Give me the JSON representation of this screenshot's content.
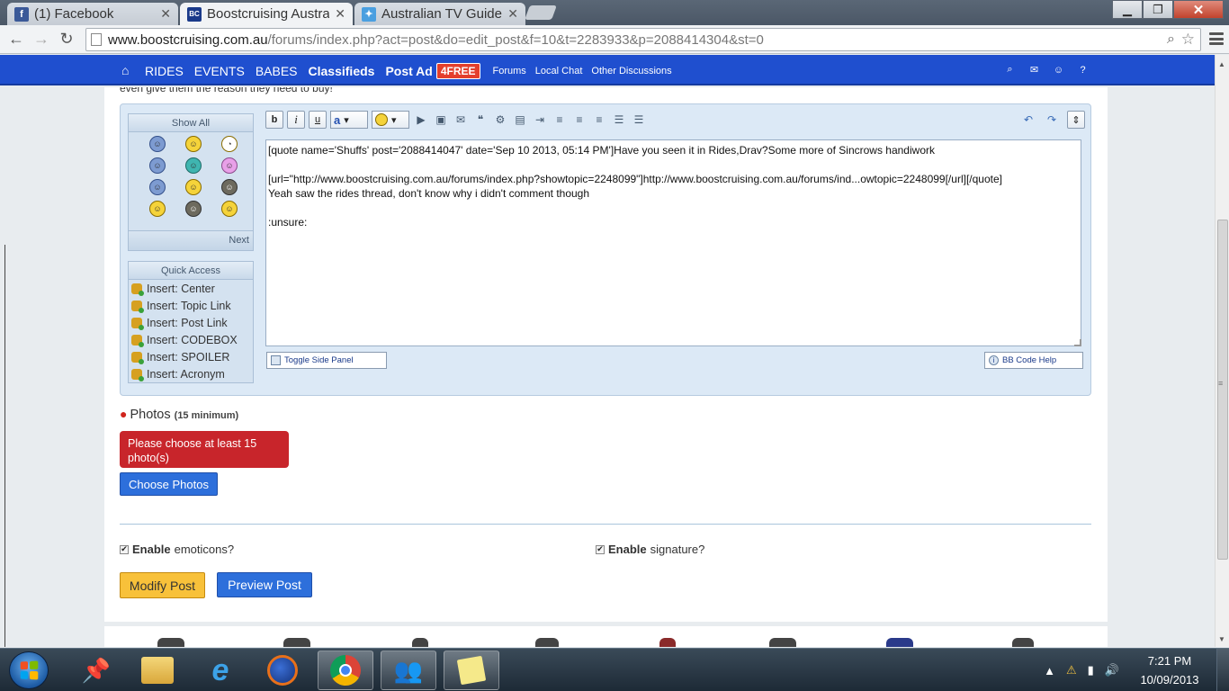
{
  "browser": {
    "tabs": [
      {
        "title": "(1) Facebook",
        "favicon": "facebook-icon",
        "color": "#3b5998",
        "glyph": "f",
        "active": false
      },
      {
        "title": "Boostcruising Austral",
        "favicon": "boostcruising-icon",
        "color": "#1a3a8a",
        "glyph": "BC",
        "active": true
      },
      {
        "title": "Australian TV Guide",
        "favicon": "tv-guide-icon",
        "color": "#4a9fe0",
        "glyph": "✦",
        "active": false
      }
    ],
    "url_host": "www.boostcruising.com.au",
    "url_path": "/forums/index.php?act=post&do=edit_post&f=10&t=2283933&p=2088414304&st=0"
  },
  "sitenav": {
    "links": [
      {
        "label": "RIDES",
        "style": "normal"
      },
      {
        "label": "EVENTS",
        "style": "normal"
      },
      {
        "label": "BABES",
        "style": "normal"
      },
      {
        "label": "Classifieds",
        "style": "bold"
      },
      {
        "label": "Post Ad",
        "style": "bold"
      }
    ],
    "badge": "4FREE",
    "sublinks": [
      "Forums",
      "Local Chat",
      "Other Discussions"
    ]
  },
  "page": {
    "top_text": "even give them the reason they need to buy!",
    "side_panel": {
      "title": "Show All",
      "next": "Next"
    },
    "quick_access": {
      "title": "Quick Access",
      "items": [
        "Insert: Center",
        "Insert: Topic Link",
        "Insert: Post Link",
        "Insert: CODEBOX",
        "Insert: SPOILER",
        "Insert: Acronym"
      ]
    },
    "editor_text": "[quote name='Shuffs' post='2088414047' date='Sep 10 2013, 05:14 PM']Have you seen it in Rides,Drav?Some more of Sincrows handiwork\n\n[url=\"http://www.boostcruising.com.au/forums/index.php?showtopic=2248099\"]http://www.boostcruising.com.au/forums/ind...owtopic=2248099[/url][/quote]\nYeah saw the rides thread, don't know why i didn't comment though\n\n:unsure:",
    "toggle_panel": "Toggle Side Panel",
    "bbcode_help": "BB Code Help",
    "photos_label": "Photos",
    "photos_min": "(15 minimum)",
    "photos_error": "Please choose at least 15 photo(s)",
    "choose_photos": "Choose Photos",
    "emoticons_bold": "Enable",
    "emoticons_rest": "emoticons?",
    "signature_bold": "Enable",
    "signature_rest": "signature?",
    "modify_post": "Modify Post",
    "preview_post": "Preview Post"
  },
  "taskbar": {
    "time": "7:21 PM",
    "date": "10/09/2013"
  }
}
